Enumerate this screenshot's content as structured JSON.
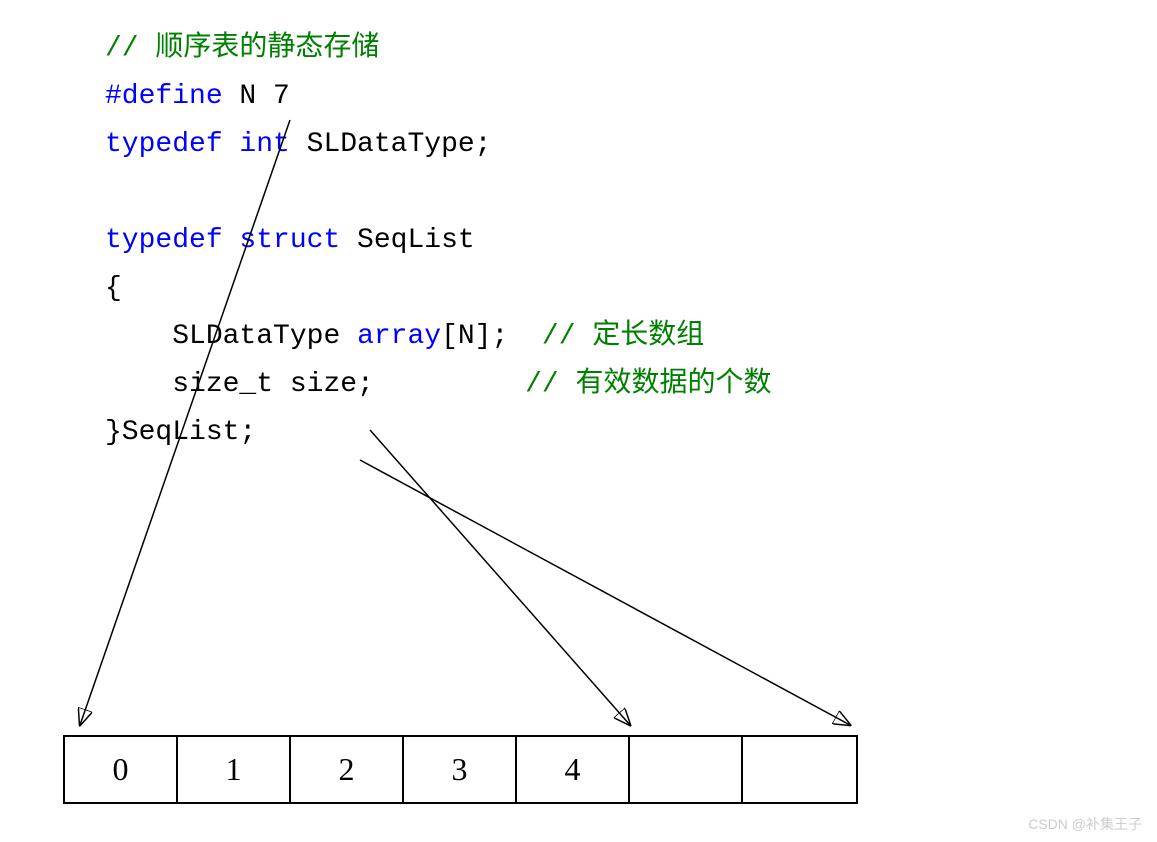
{
  "code": {
    "line1_comment": "// 顺序表的静态存储",
    "line2_define": "#define",
    "line2_rest": " N 7",
    "line3_typedef": "typedef ",
    "line3_int": "int",
    "line3_rest": " SLDataType;",
    "line4_typedef": "typedef ",
    "line4_struct": "struct",
    "line4_rest": " SeqList",
    "line5_brace": "{",
    "line6_indent": "    ",
    "line6_type": "SLDataType ",
    "line6_array": "array",
    "line6_dim": "[N];",
    "line6_comment": "  // 定长数组",
    "line7_indent": "    ",
    "line7_text": "size_t size;",
    "line7_comment": "         // 有效数据的个数",
    "line8_close": "}SeqList;"
  },
  "array_cells": {
    "c0": "0",
    "c1": "1",
    "c2": "2",
    "c3": "3",
    "c4": "4",
    "c5": "",
    "c6": ""
  },
  "watermark": "CSDN @补集王子"
}
